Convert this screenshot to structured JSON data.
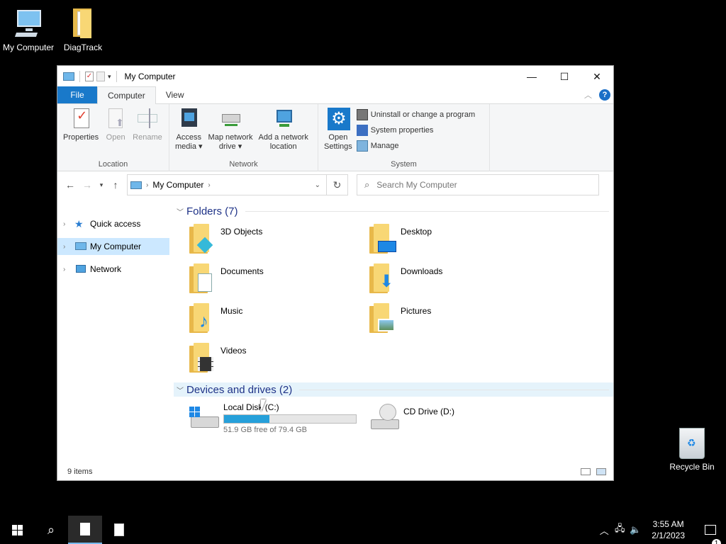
{
  "desktop": {
    "icons": [
      {
        "label": "My Computer",
        "icon": "computer-icon"
      },
      {
        "label": "DiagTrack",
        "icon": "folder-icon"
      },
      {
        "label": "Recycle Bin",
        "icon": "recycle-bin-icon"
      }
    ]
  },
  "window": {
    "title": "My Computer",
    "tabs": [
      "File",
      "Computer",
      "View"
    ],
    "active_tab": "Computer",
    "ribbon": {
      "location": {
        "name": "Location",
        "buttons": [
          "Properties",
          "Open",
          "Rename"
        ]
      },
      "network": {
        "name": "Network",
        "access_media": "Access\nmedia ▾",
        "map_drive": "Map network\ndrive ▾",
        "add_location": "Add a network\nlocation"
      },
      "system": {
        "name": "System",
        "open_settings": "Open\nSettings",
        "uninstall": "Uninstall or change a program",
        "system_properties": "System properties",
        "manage": "Manage"
      }
    },
    "address": {
      "path": "My Computer"
    },
    "search": {
      "placeholder": "Search My Computer"
    },
    "nav": {
      "items": [
        {
          "label": "Quick access",
          "icon": "star-icon"
        },
        {
          "label": "My Computer",
          "icon": "computer-icon"
        },
        {
          "label": "Network",
          "icon": "network-icon"
        }
      ]
    },
    "folders": {
      "header": "Folders (7)",
      "items": [
        {
          "name": "3D Objects",
          "icon": "3d-objects-icon"
        },
        {
          "name": "Desktop",
          "icon": "desktop-folder-icon"
        },
        {
          "name": "Documents",
          "icon": "documents-icon"
        },
        {
          "name": "Downloads",
          "icon": "downloads-icon"
        },
        {
          "name": "Music",
          "icon": "music-icon"
        },
        {
          "name": "Pictures",
          "icon": "pictures-icon"
        },
        {
          "name": "Videos",
          "icon": "videos-icon"
        }
      ]
    },
    "devices": {
      "header": "Devices and drives (2)",
      "local_disk": {
        "name": "Local Disk (C:)",
        "free_text": "51.9 GB free of 79.4 GB",
        "used_fraction": 0.346
      },
      "cd_drive": {
        "name": "CD Drive (D:)"
      }
    },
    "status": {
      "items": "9 items"
    }
  },
  "taskbar": {
    "time": "3:55 AM",
    "date": "2/1/2023",
    "notifications": "1"
  },
  "colors": {
    "accent": "#1979ca",
    "selection": "#cce8ff",
    "drive_bar": "#26a0da"
  }
}
